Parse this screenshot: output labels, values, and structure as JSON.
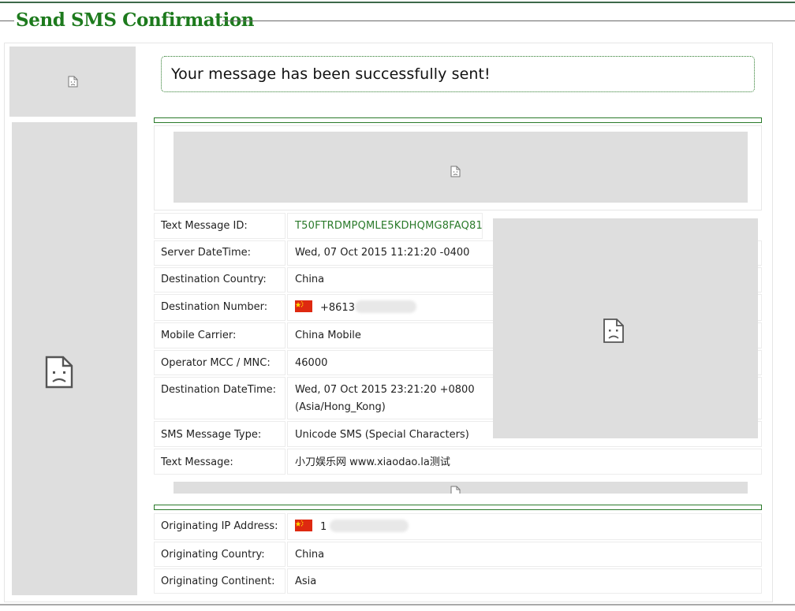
{
  "page": {
    "title": "Send SMS Confirmation",
    "success_message": "Your message has been successfully sent!"
  },
  "details": [
    {
      "label": "Text Message ID:",
      "value": "T50FTRDMPQMLE5KDHQMG8FAQ81"
    },
    {
      "label": "Server DateTime:",
      "value": "Wed, 07 Oct 2015 11:21:20 -0400"
    },
    {
      "label": "Destination Country:",
      "value": "China"
    },
    {
      "label": "Destination Number:",
      "value": "+8613",
      "flag": "china-flag-icon"
    },
    {
      "label": "Mobile Carrier:",
      "value": "China Mobile"
    },
    {
      "label": "Operator MCC / MNC:",
      "value": "46000"
    },
    {
      "label": "Destination DateTime:",
      "value": "Wed, 07 Oct 2015 23:21:20 +0800",
      "value_line2": "(Asia/Hong_Kong)"
    },
    {
      "label": "SMS Message Type:",
      "value": "Unicode SMS (Special Characters)"
    },
    {
      "label": "Text Message:",
      "value": "小刀娱乐网 www.xiaodao.la测试"
    }
  ],
  "origin": [
    {
      "label": "Originating IP Address:",
      "value": "1",
      "flag": "china-flag-icon"
    },
    {
      "label": "Originating Country:",
      "value": "China"
    },
    {
      "label": "Originating Continent:",
      "value": "Asia"
    }
  ],
  "colors": {
    "title": "#1d7a1d",
    "accent_border": "#2a7a2a",
    "placeholder": "#dedede"
  },
  "icons": {
    "broken_image": "broken-image-icon"
  }
}
